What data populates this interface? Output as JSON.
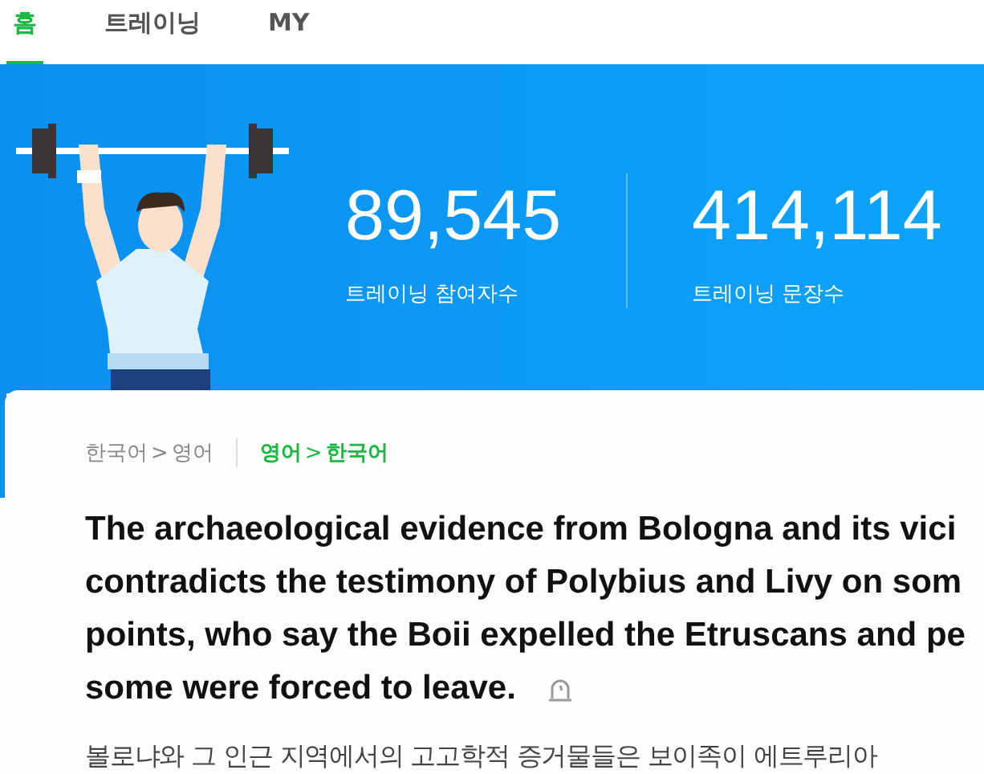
{
  "tabs": [
    {
      "label": "홈",
      "selected": true
    },
    {
      "label": "트레이닝",
      "selected": false
    },
    {
      "label": "MY",
      "selected": false
    }
  ],
  "stats": [
    {
      "value": "89,545",
      "label": "트레이닝 참여자수"
    },
    {
      "value": "414,114",
      "label": "트레이닝 문장수"
    }
  ],
  "language_options": [
    {
      "from": "한국어",
      "arrow": ">",
      "to": "영어",
      "selected": false
    },
    {
      "from": "영어",
      "arrow": ">",
      "to": "한국어",
      "selected": true
    }
  ],
  "sentence_lines": [
    "The archaeological evidence from Bologna and its vici",
    "contradicts the testimony of Polybius and Livy on som",
    "points, who say the Boii expelled the Etruscans and pe",
    "some were forced to leave."
  ],
  "translation": "볼로냐와 그 인근 지역에서의 고고학적 증거물들은 보이족이 에트루리아"
}
